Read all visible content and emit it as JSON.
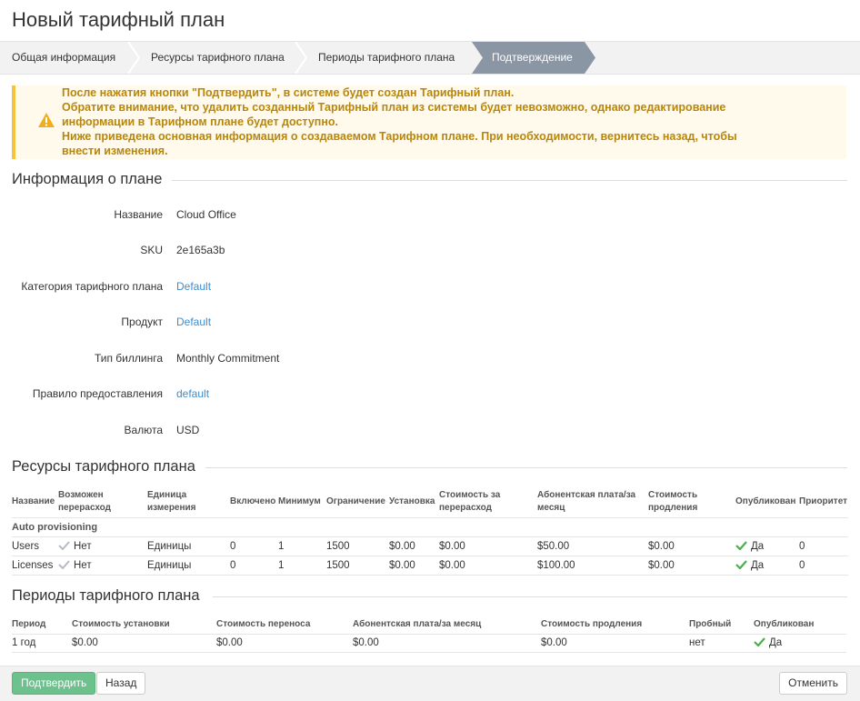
{
  "page_title": "Новый тарифный план",
  "wizard": {
    "steps": [
      "Общая информация",
      "Ресурсы тарифного плана",
      "Периоды тарифного плана",
      "Подтверждение"
    ]
  },
  "warning": {
    "lines": [
      "После нажатия кнопки \"Подтвердить\", в системе будет создан Тарифный план.",
      "Обратите внимание, что удалить созданный Тарифный план из системы будет невозможно, однако редактирование",
      "информации в Тарифном плане будет доступно.",
      "Ниже приведена основная информация о создаваемом Тарифном плане. При необходимости, вернитесь назад, чтобы",
      "внести изменения."
    ],
    "color": "#b8860b",
    "accent": "#f5c340"
  },
  "plan_info": {
    "title": "Информация о плане",
    "fields": [
      {
        "label": "Название",
        "value": "Cloud Office"
      },
      {
        "label": "SKU",
        "value": "2e165a3b"
      },
      {
        "label": "Категория тарифного плана",
        "value": "Default"
      },
      {
        "label": "Продукт",
        "value": "Default"
      },
      {
        "label": "Тип биллинга",
        "value": "Monthly Commitment"
      },
      {
        "label": "Правило предоставления",
        "value": "default"
      },
      {
        "label": "Валюта",
        "value": "USD"
      }
    ]
  },
  "resources": {
    "title": "Ресурсы тарифного плана",
    "headers": [
      "Название",
      "Возможен перерасход",
      "Единица измерения",
      "Включено",
      "Минимум",
      "Ограничение",
      "Установка",
      "Стоимость за перерасход",
      "Абонентская плата/за месяц",
      "Стоимость продления",
      "Опубликован",
      "Приоритет"
    ],
    "group": "Auto provisioning",
    "rows": [
      [
        "Users",
        "Нет",
        "Единицы",
        "0",
        "1",
        "1500",
        "$0.00",
        "$0.00",
        "$50.00",
        "$0.00",
        "Да",
        "0"
      ],
      [
        "Licenses",
        "Нет",
        "Единицы",
        "0",
        "1",
        "1500",
        "$0.00",
        "$0.00",
        "$100.00",
        "$0.00",
        "Да",
        "0"
      ]
    ]
  },
  "periods": {
    "title": "Периоды тарифного плана",
    "headers": [
      "Период",
      "Стоимость установки",
      "Стоимость переноса",
      "Абонентская плата/за месяц",
      "Стоимость продления",
      "Пробный",
      "Опубликован"
    ],
    "rows": [
      [
        "1 год",
        "$0.00",
        "$0.00",
        "$0.00",
        "$0.00",
        "нет",
        "Да"
      ]
    ]
  },
  "footer": {
    "confirm_label": "Подтвердить",
    "back_label": "Назад",
    "cancel_label": "Отменить"
  },
  "colors": {
    "link": "#3b8ed0",
    "check_green": "#4cae4c",
    "check_gray": "#b5bcc4",
    "active_step": "#8b96a4",
    "primary_button": "#6cc18c"
  }
}
